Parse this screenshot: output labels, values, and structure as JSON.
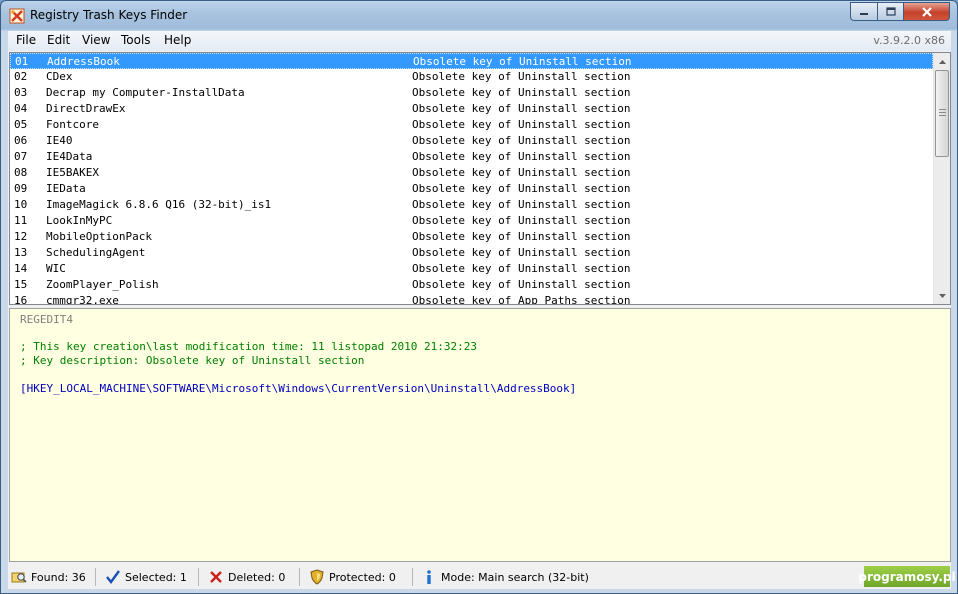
{
  "window": {
    "title": "Registry Trash Keys Finder"
  },
  "menu": {
    "items": [
      "File",
      "Edit",
      "View",
      "Tools",
      "Help"
    ],
    "version": "v.3.9.2.0 x86"
  },
  "list": {
    "rows": [
      {
        "num": "01",
        "name": "AddressBook",
        "desc": "Obsolete key of Uninstall section",
        "selected": true
      },
      {
        "num": "02",
        "name": "CDex",
        "desc": "Obsolete key of Uninstall section"
      },
      {
        "num": "03",
        "name": "Decrap my Computer-InstallData",
        "desc": "Obsolete key of Uninstall section"
      },
      {
        "num": "04",
        "name": "DirectDrawEx",
        "desc": "Obsolete key of Uninstall section"
      },
      {
        "num": "05",
        "name": "Fontcore",
        "desc": "Obsolete key of Uninstall section"
      },
      {
        "num": "06",
        "name": "IE40",
        "desc": "Obsolete key of Uninstall section"
      },
      {
        "num": "07",
        "name": "IE4Data",
        "desc": "Obsolete key of Uninstall section"
      },
      {
        "num": "08",
        "name": "IE5BAKEX",
        "desc": "Obsolete key of Uninstall section"
      },
      {
        "num": "09",
        "name": "IEData",
        "desc": "Obsolete key of Uninstall section"
      },
      {
        "num": "10",
        "name": "ImageMagick 6.8.6 Q16 (32-bit)_is1",
        "desc": "Obsolete key of Uninstall section"
      },
      {
        "num": "11",
        "name": "LookInMyPC",
        "desc": "Obsolete key of Uninstall section"
      },
      {
        "num": "12",
        "name": "MobileOptionPack",
        "desc": "Obsolete key of Uninstall section"
      },
      {
        "num": "13",
        "name": "SchedulingAgent",
        "desc": "Obsolete key of Uninstall section"
      },
      {
        "num": "14",
        "name": "WIC",
        "desc": "Obsolete key of Uninstall section"
      },
      {
        "num": "15",
        "name": "ZoomPlayer_Polish",
        "desc": "Obsolete key of Uninstall section"
      },
      {
        "num": "16",
        "name": "cmmgr32.exe",
        "desc": "Obsolete key of App Paths section"
      }
    ]
  },
  "details": {
    "header": "REGEDIT4",
    "comment_time": "; This key creation\\last modification time: 11 listopad 2010 21:32:23",
    "comment_desc": "; Key description: Obsolete key of Uninstall section",
    "key_path": "[HKEY_LOCAL_MACHINE\\SOFTWARE\\Microsoft\\Windows\\CurrentVersion\\Uninstall\\AddressBook]"
  },
  "status": {
    "found": "Found: 36",
    "selected": "Selected: 1",
    "deleted": "Deleted: 0",
    "protected": "Protected: 0",
    "mode": "Mode: Main search (32-bit)",
    "brand": "programosy.pl"
  },
  "colors": {
    "selection": "#3399ff",
    "details_bg": "#ffffe1",
    "comment": "#008000",
    "key": "#0000c0",
    "brand": "#7fb832"
  }
}
